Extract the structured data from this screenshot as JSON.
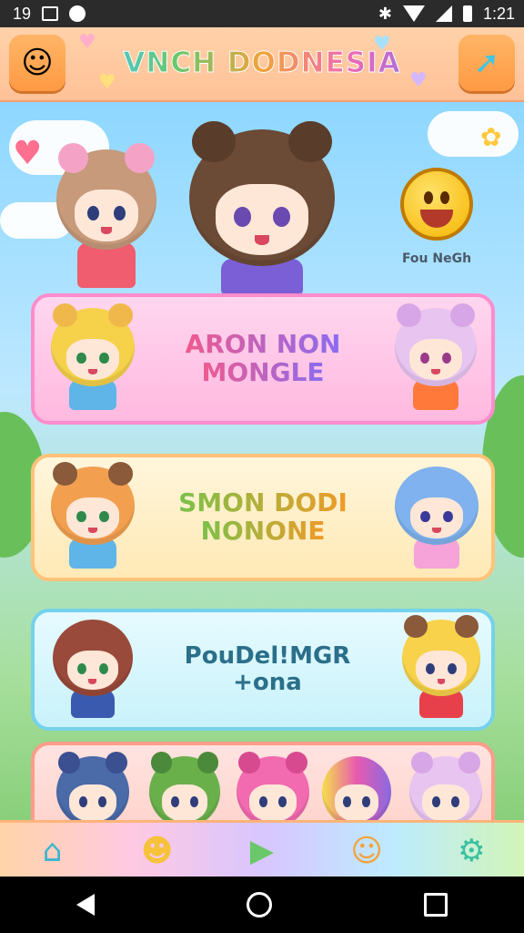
{
  "status_bar": {
    "left_text": "19",
    "time": "1:21",
    "icons": [
      "gallery-icon",
      "notification-dot-icon",
      "bluetooth-icon",
      "wifi-icon",
      "signal-icon",
      "battery-icon"
    ]
  },
  "header": {
    "title": "VNCH DODNESIA",
    "left_button_icon": "character-avatar-icon",
    "right_button_icon": "pointer-arrow-icon"
  },
  "scene": {
    "badge_label": "Fou NeGh",
    "featured_characters": [
      "character-brown-hair-girl",
      "character-bear-ear-boy"
    ]
  },
  "cards": [
    {
      "line1": "ARON NON",
      "line2": "MONGLE",
      "theme": "#ff8ccc"
    },
    {
      "line1": "SMON DODI",
      "line2": "NONONE",
      "theme": "#ffc37a"
    },
    {
      "line1": "PouDel!MGR +ona",
      "line2": "",
      "theme": "#75d2ea"
    },
    {
      "line1": "",
      "line2": "",
      "theme": "#ff9c8a"
    }
  ],
  "bottom_nav": [
    "home-icon",
    "mascot-icon",
    "play-icon",
    "creature-icon",
    "robot-icon"
  ],
  "system_nav": [
    "back-icon",
    "home-circle-icon",
    "recents-icon"
  ]
}
